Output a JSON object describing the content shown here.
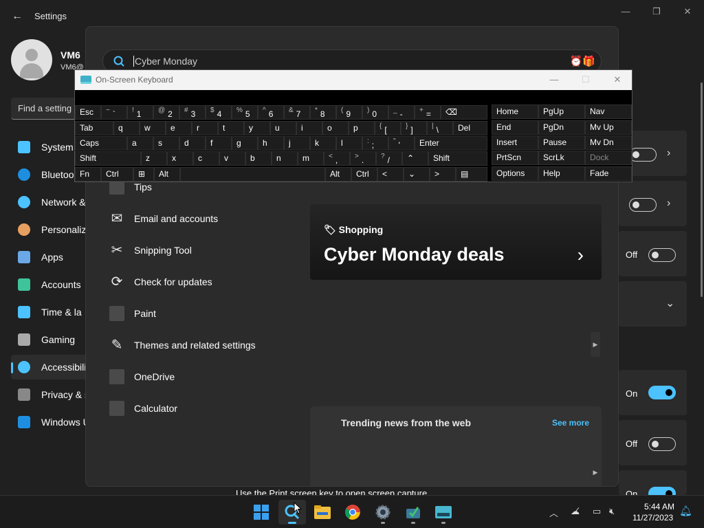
{
  "settings": {
    "title": "Settings",
    "user": {
      "name": "VM6",
      "email": "VM6@"
    },
    "find_placeholder": "Find a setting",
    "nav": [
      {
        "label": "System",
        "icon": "monitor-icon",
        "color": "#4cc2ff"
      },
      {
        "label": "Bluetoo",
        "icon": "bluetooth-icon",
        "color": "#1e8fe0"
      },
      {
        "label": "Network &",
        "icon": "wifi-icon",
        "color": "#4cc2ff"
      },
      {
        "label": "Personaliz",
        "icon": "brush-icon",
        "color": "#e8a060"
      },
      {
        "label": "Apps",
        "icon": "apps-icon",
        "color": "#6aa8e8"
      },
      {
        "label": "Accounts",
        "icon": "person-icon",
        "color": "#3fc39a"
      },
      {
        "label": "Time & la",
        "icon": "clock-icon",
        "color": "#4cc2ff"
      },
      {
        "label": "Gaming",
        "icon": "gamepad-icon",
        "color": "#aaaaaa"
      },
      {
        "label": "Accessibili",
        "icon": "accessibility-icon",
        "color": "#4cc2ff"
      },
      {
        "label": "Privacy & s",
        "icon": "shield-icon",
        "color": "#888888"
      },
      {
        "label": "Windows U",
        "icon": "update-icon",
        "color": "#1e8fe0"
      }
    ],
    "toggles": {
      "t1": "Off",
      "t2": "f",
      "t3": "Off",
      "t4": "On",
      "t5": "Off",
      "t6": "On"
    },
    "print_screen_text": "Use the Print screen key to open screen capture"
  },
  "search": {
    "query": "Cyber Monday",
    "results": [
      {
        "label": "Tips",
        "icon": "tips-icon"
      },
      {
        "label": "Email and accounts",
        "icon": "mail-icon"
      },
      {
        "label": "Snipping Tool",
        "icon": "snipping-tool-icon"
      },
      {
        "label": "Check for updates",
        "icon": "refresh-icon"
      },
      {
        "label": "Paint",
        "icon": "paint-icon"
      },
      {
        "label": "Themes and related settings",
        "icon": "brush-icon"
      },
      {
        "label": "OneDrive",
        "icon": "onedrive-icon"
      },
      {
        "label": "Calculator",
        "icon": "calculator-icon"
      }
    ],
    "promo": {
      "tag": "Shopping",
      "title": "Cyber Monday deals"
    },
    "news": {
      "title": "Trending news from the web",
      "see_more": "See more"
    }
  },
  "osk": {
    "title": "On-Screen Keyboard",
    "rows": [
      [
        {
          "m": "Esc"
        },
        {
          "s": "~",
          "m": "`"
        },
        {
          "s": "!",
          "m": "1"
        },
        {
          "s": "@",
          "m": "2"
        },
        {
          "s": "#",
          "m": "3"
        },
        {
          "s": "$",
          "m": "4"
        },
        {
          "s": "%",
          "m": "5"
        },
        {
          "s": "^",
          "m": "6"
        },
        {
          "s": "&",
          "m": "7"
        },
        {
          "s": "*",
          "m": "8"
        },
        {
          "s": "(",
          "m": "9"
        },
        {
          "s": ")",
          "m": "0"
        },
        {
          "s": "_",
          "m": "-"
        },
        {
          "s": "+",
          "m": "="
        },
        {
          "m": "⌫"
        }
      ],
      [
        {
          "m": "Tab"
        },
        {
          "m": "q"
        },
        {
          "m": "w"
        },
        {
          "m": "e"
        },
        {
          "m": "r"
        },
        {
          "m": "t"
        },
        {
          "m": "y"
        },
        {
          "m": "u"
        },
        {
          "m": "i"
        },
        {
          "m": "o"
        },
        {
          "m": "p"
        },
        {
          "s": "{",
          "m": "["
        },
        {
          "s": "}",
          "m": "]"
        },
        {
          "s": "|",
          "m": "\\"
        },
        {
          "m": "Del"
        }
      ],
      [
        {
          "m": "Caps"
        },
        {
          "m": "a"
        },
        {
          "m": "s"
        },
        {
          "m": "d"
        },
        {
          "m": "f"
        },
        {
          "m": "g"
        },
        {
          "m": "h"
        },
        {
          "m": "j"
        },
        {
          "m": "k"
        },
        {
          "m": "l"
        },
        {
          "s": ":",
          "m": ";"
        },
        {
          "s": "\"",
          "m": "'"
        },
        {
          "m": "Enter"
        }
      ],
      [
        {
          "m": "Shift"
        },
        {
          "m": "z"
        },
        {
          "m": "x"
        },
        {
          "m": "c"
        },
        {
          "m": "v"
        },
        {
          "m": "b"
        },
        {
          "m": "n"
        },
        {
          "m": "m"
        },
        {
          "s": "<",
          "m": ","
        },
        {
          "s": ">",
          "m": "."
        },
        {
          "s": "?",
          "m": "/"
        },
        {
          "m": "⌃"
        },
        {
          "m": "Shift"
        }
      ],
      [
        {
          "m": "Fn"
        },
        {
          "m": "Ctrl"
        },
        {
          "m": "⊞"
        },
        {
          "m": "Alt"
        },
        {
          "m": ""
        },
        {
          "m": "Alt"
        },
        {
          "m": "Ctrl"
        },
        {
          "m": "<"
        },
        {
          "m": "⌄"
        },
        {
          "m": ">"
        },
        {
          "m": "▤"
        }
      ]
    ],
    "nav_keys": [
      [
        "Home",
        "PgUp",
        "Nav"
      ],
      [
        "End",
        "PgDn",
        "Mv Up"
      ],
      [
        "Insert",
        "Pause",
        "Mv Dn"
      ],
      [
        "PrtScn",
        "ScrLk",
        "Dock"
      ],
      [
        "Options",
        "Help",
        "Fade"
      ]
    ]
  },
  "taskbar": {
    "time": "5:44 AM",
    "date": "11/27/2023",
    "apps": [
      "start-icon",
      "search-icon",
      "file-explorer-icon",
      "chrome-icon",
      "settings-icon",
      "app-icon",
      "on-screen-keyboard-icon"
    ]
  },
  "colors": {
    "accent": "#4cc2ff",
    "background": "#202020",
    "panel": "#2b2b2b"
  }
}
